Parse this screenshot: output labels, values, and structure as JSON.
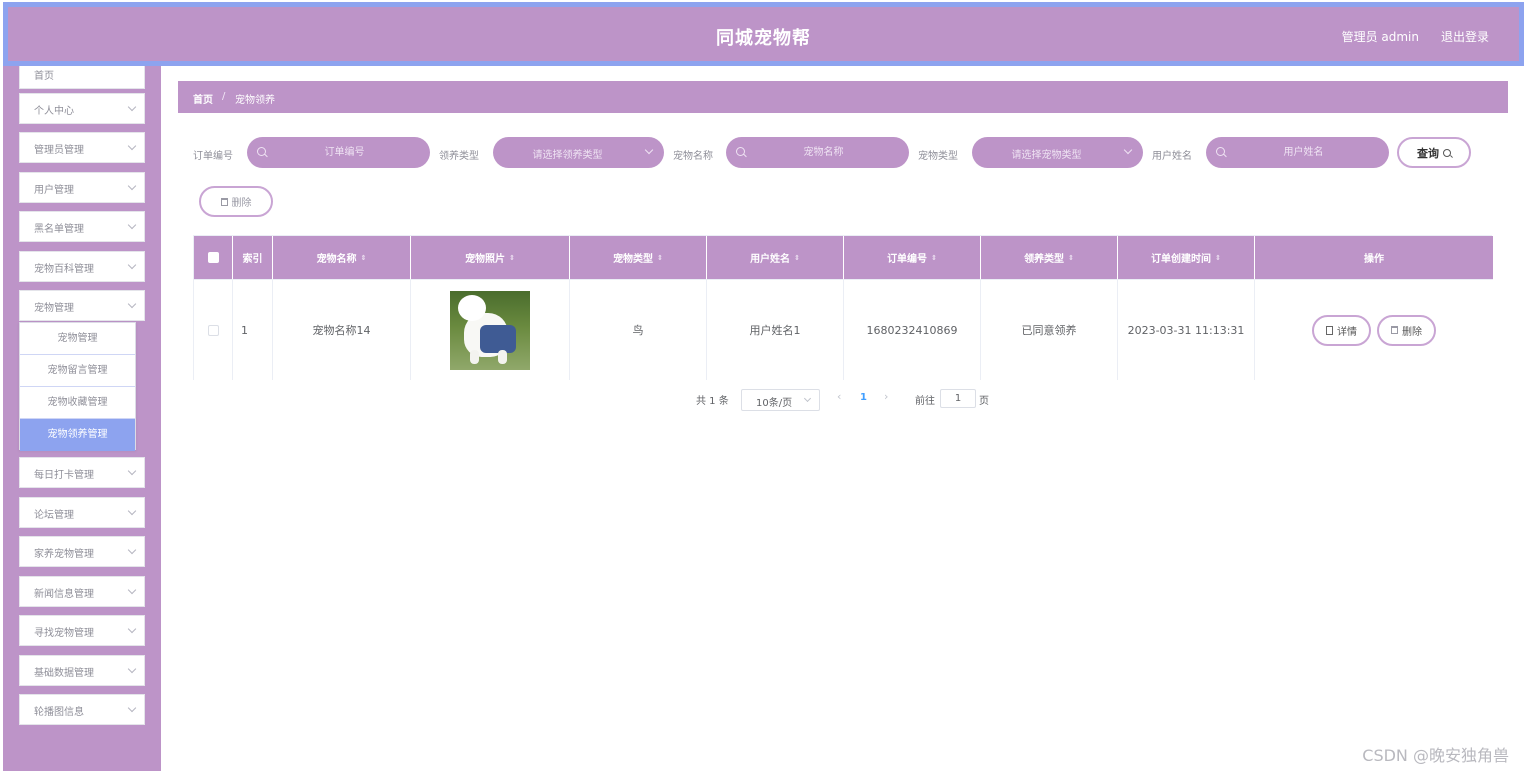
{
  "header": {
    "title": "同城宠物帮",
    "user_label": "管理员 admin",
    "logout_label": "退出登录"
  },
  "sidebar": {
    "items": [
      {
        "label": "首页",
        "has_chevron": false
      },
      {
        "label": "个人中心",
        "has_chevron": true
      },
      {
        "label": "管理员管理",
        "has_chevron": true
      },
      {
        "label": "用户管理",
        "has_chevron": true
      },
      {
        "label": "黑名单管理",
        "has_chevron": true
      },
      {
        "label": "宠物百科管理",
        "has_chevron": true
      },
      {
        "label": "宠物管理",
        "has_chevron": true
      },
      {
        "label": "每日打卡管理",
        "has_chevron": true
      },
      {
        "label": "论坛管理",
        "has_chevron": true
      },
      {
        "label": "家养宠物管理",
        "has_chevron": true
      },
      {
        "label": "新闻信息管理",
        "has_chevron": true
      },
      {
        "label": "寻找宠物管理",
        "has_chevron": true
      },
      {
        "label": "基础数据管理",
        "has_chevron": true
      },
      {
        "label": "轮播图信息",
        "has_chevron": true
      }
    ],
    "submenu": [
      {
        "label": "宠物管理",
        "active": false
      },
      {
        "label": "宠物留言管理",
        "active": false
      },
      {
        "label": "宠物收藏管理",
        "active": false
      },
      {
        "label": "宠物领养管理",
        "active": true
      }
    ]
  },
  "breadcrumb": {
    "home": "首页",
    "separator": "/",
    "current": "宠物领养"
  },
  "search": {
    "order_no_label": "订单编号",
    "order_no_placeholder": "订单编号",
    "adopt_type_label": "领养类型",
    "adopt_type_placeholder": "请选择领养类型",
    "pet_name_label": "宠物名称",
    "pet_name_placeholder": "宠物名称",
    "pet_type_label": "宠物类型",
    "pet_type_placeholder": "请选择宠物类型",
    "user_name_label": "用户姓名",
    "user_name_placeholder": "用户姓名",
    "query_button": "查询",
    "delete_button": "删除"
  },
  "table": {
    "columns": [
      "索引",
      "宠物名称",
      "宠物照片",
      "宠物类型",
      "用户姓名",
      "订单编号",
      "领养类型",
      "订单创建时间",
      "操作"
    ],
    "rows": [
      {
        "index": "1",
        "pet_name": "宠物名称14",
        "pet_type": "鸟",
        "user_name": "用户姓名1",
        "order_no": "1680232410869",
        "adopt_type": "已同意领养",
        "created_at": "2023-03-31 11:13:31",
        "detail_button": "详情",
        "delete_button": "删除"
      }
    ]
  },
  "pagination": {
    "total_text": "共 1 条",
    "page_size": "10条/页",
    "current_page": "1",
    "goto_label": "前往",
    "goto_value": "1",
    "goto_unit": "页"
  },
  "watermark": "CSDN @晚安独角兽",
  "colors": {
    "primary": "#bd94c8",
    "accent": "#8da3ef"
  }
}
